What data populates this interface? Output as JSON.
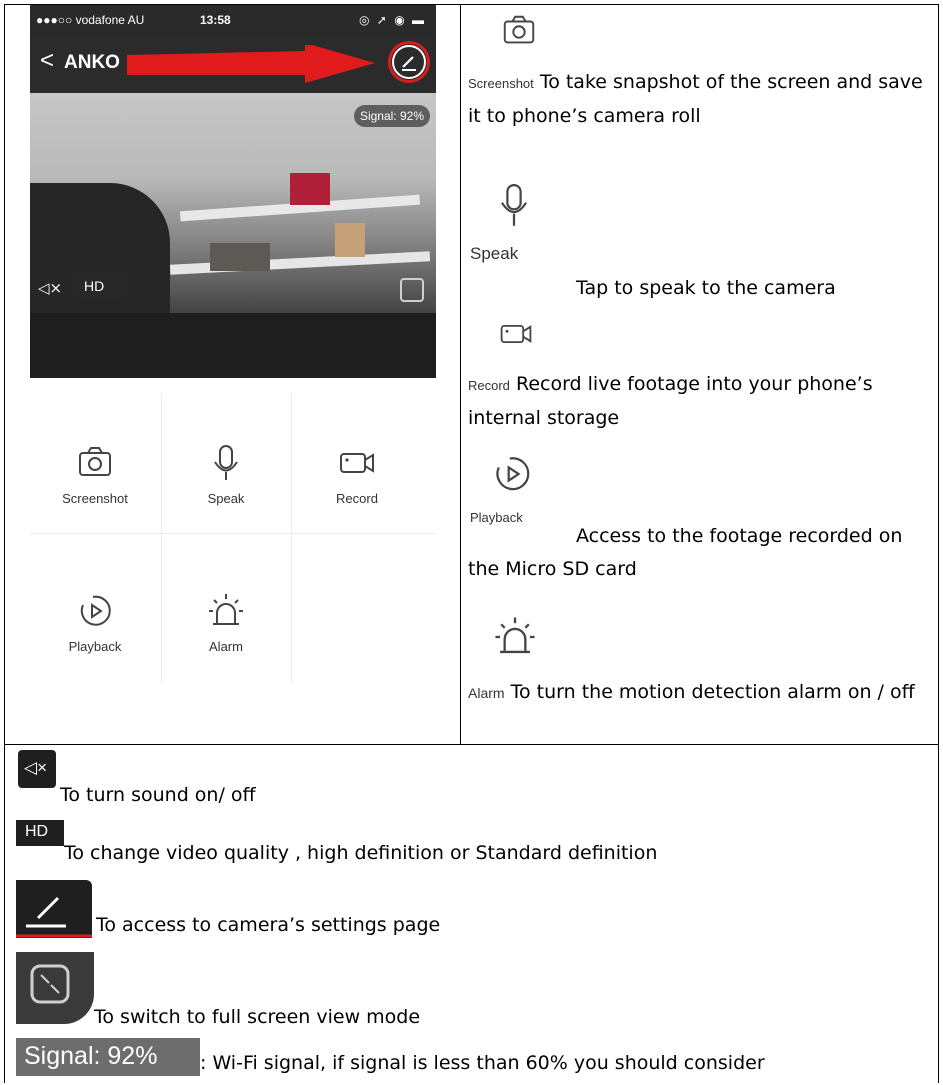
{
  "phone": {
    "status_bar": {
      "carrier": "●●●○○ vodafone AU",
      "time": "13:58"
    },
    "nav": {
      "back_glyph": "<",
      "title": "ANKO"
    },
    "video": {
      "signal": "Signal: 92%",
      "quality": "HD"
    },
    "grid": [
      {
        "label": "Screenshot",
        "icon": "camera-icon"
      },
      {
        "label": "Speak",
        "icon": "microphone-icon"
      },
      {
        "label": "Record",
        "icon": "video-camera-icon"
      },
      {
        "label": "Playback",
        "icon": "playback-icon"
      },
      {
        "label": "Alarm",
        "icon": "alarm-icon"
      }
    ]
  },
  "descriptions": {
    "screenshot": {
      "label": "Screenshot",
      "text": "To take snapshot of the screen and save it to phone’s camera roll"
    },
    "speak": {
      "label": "Speak",
      "text": "Tap to speak to the camera"
    },
    "record": {
      "label": "Record",
      "text": "Record live footage into your phone’s internal storage"
    },
    "playback": {
      "label": "Playback",
      "text": "Access to the footage recorded on the Micro SD card"
    },
    "alarm": {
      "label": "Alarm",
      "text": "To turn the motion detection alarm on / off"
    }
  },
  "legend": {
    "sound": "To turn sound on/ off",
    "hd_label": "HD",
    "hd": "To change video quality , high definition or Standard definition",
    "settings": "To access to camera’s settings page",
    "fullscreen": "To switch to full screen view mode",
    "signal_label": "Signal: 92%",
    "signal": ": Wi-Fi signal, if signal is less than 60% you should consider"
  },
  "colors": {
    "arrow": "#e11b1b",
    "dark_bar": "#2b2b2b",
    "icon_stroke": "#444444"
  }
}
